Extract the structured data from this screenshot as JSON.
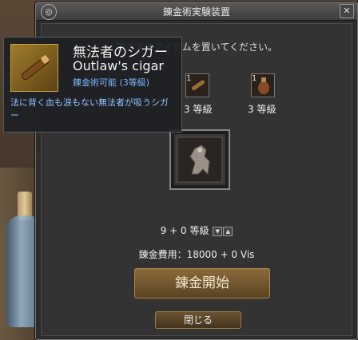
{
  "window": {
    "title": "錬金術実験装置",
    "close_label": "✕",
    "logo_glyph": "◎"
  },
  "panel": {
    "instruction": "錬金するアイテムを置いてください。",
    "materials": [
      {
        "index": "1",
        "grade": "3 等級"
      },
      {
        "index": "1",
        "grade": "3 等級"
      }
    ],
    "grade_line": "9 + 0 等級",
    "grade_down": "▼",
    "grade_up": "▲",
    "cost_line": "錬金費用：18000 + 0 Vis",
    "start_button": "錬金開始",
    "close_button": "閉じる"
  },
  "tooltip": {
    "name_jp": "無法者のシガー",
    "name_en": "Outlaw's cigar",
    "status": "錬金術可能 (3等級)",
    "description": "法に背く血も涙もない無法者が吸うシガー"
  },
  "colors": {
    "accent_gold": "#b08a4e",
    "tooltip_blue": "#8fc3ff",
    "status_blue": "#7fb3ff"
  },
  "icons": {
    "logo": "emblem-icon",
    "close": "close-icon",
    "item": "cigar-icon",
    "main_item": "lion-crest-icon"
  }
}
